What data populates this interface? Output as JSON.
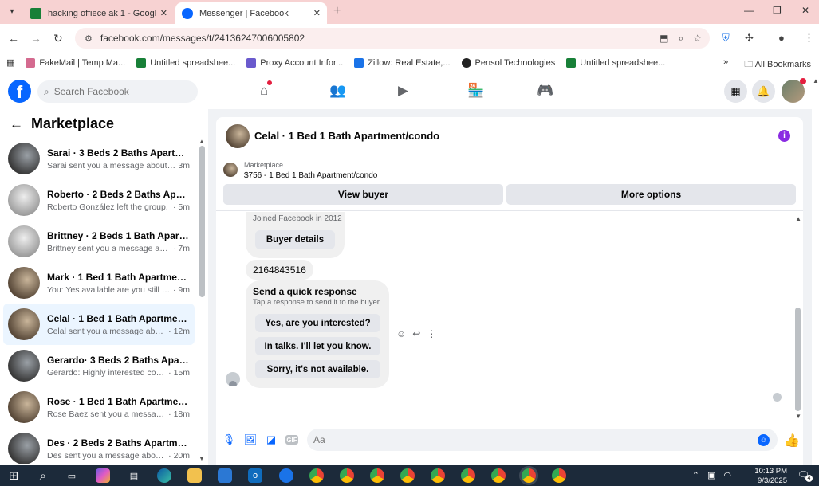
{
  "browser": {
    "tabs": [
      {
        "label": "hacking offiece ak 1 - Google S",
        "icon": "sheets-icon"
      },
      {
        "label": "Messenger | Facebook",
        "icon": "facebook-icon"
      }
    ],
    "new_tab": "+",
    "controls": {
      "minimize": "—",
      "maximize": "❐",
      "close": "✕"
    },
    "url": "facebook.com/messages/t/24136247006005802",
    "bookmarks": [
      {
        "label": "FakeMail | Temp Ma...",
        "icon": "fakemail-icon"
      },
      {
        "label": "Untitled spreadshee...",
        "icon": "sheets-icon"
      },
      {
        "label": "Proxy Account Infor...",
        "icon": "proxy-icon"
      },
      {
        "label": "Zillow: Real Estate,...",
        "icon": "zillow-icon"
      },
      {
        "label": "Pensol Technologies",
        "icon": "pensol-icon"
      },
      {
        "label": "Untitled spreadshee...",
        "icon": "sheets-icon"
      }
    ],
    "bookmarks_more": "»",
    "all_bookmarks": "All Bookmarks"
  },
  "facebook": {
    "logo": "f",
    "search_placeholder": "Search Facebook"
  },
  "sidebar": {
    "title": "Marketplace",
    "conversations": [
      {
        "name": "Sarai · 3 Beds 2 Baths Apartmen...",
        "preview": "Sarai sent you a message about yo...",
        "time": "3m",
        "thumb": "dark"
      },
      {
        "name": "Roberto · 2 Beds 2 Baths Apart...",
        "preview": "Roberto González left the group.",
        "time": "· 5m",
        "thumb": "light"
      },
      {
        "name": "Brittney · 2 Beds 1 Bath Apartm...",
        "preview": "Brittney sent you a message about...",
        "time": "· 7m",
        "thumb": "light"
      },
      {
        "name": "Mark · 1 Bed 1 Bath Apartment/...",
        "preview": "You: Yes available are you still inter...",
        "time": "· 9m",
        "thumb": "warm"
      },
      {
        "name": "Celal · 1 Bed 1 Bath Apartment/c...",
        "preview": "Celal sent you a message about y...",
        "time": "· 12m",
        "thumb": "warm"
      },
      {
        "name": "Gerardo· 3 Beds 2 Baths Apartm...",
        "preview": "Gerardo: Highly interested conta...",
        "time": "· 15m",
        "thumb": "dark"
      },
      {
        "name": "Rose · 1 Bed 1 Bath Apartment/c...",
        "preview": "Rose Baez sent you a message a...",
        "time": "· 18m",
        "thumb": "warm"
      },
      {
        "name": "Des · 2 Beds 2 Baths Apartment...",
        "preview": "Des sent you a message about y...",
        "time": "· 20m",
        "thumb": "dark"
      }
    ]
  },
  "chat": {
    "title": "Celal · 1 Bed 1 Bath Apartment/condo",
    "listing_category": "Marketplace",
    "listing_price": "$756 - 1 Bed 1 Bath Apartment/condo",
    "view_buyer": "View buyer",
    "more_options": "More options",
    "joined": "Joined Facebook in 2012",
    "buyer_details": "Buyer details",
    "phone": "2164843516",
    "quick_title": "Send a quick response",
    "quick_sub": "Tap a response to send it to the buyer.",
    "quick_responses": [
      "Yes, are you interested?",
      "In talks. I'll let you know.",
      "Sorry, it's not available."
    ],
    "composer_placeholder": "Aa"
  },
  "taskbar": {
    "time": "10:13 PM",
    "date": "9/3/2025",
    "notifications": "4"
  },
  "colors": {
    "facebook_blue": "#0866ff",
    "tabbar": "#f7d2d2",
    "active_convo": "#ebf5ff",
    "info_purple": "#8a2be2"
  }
}
